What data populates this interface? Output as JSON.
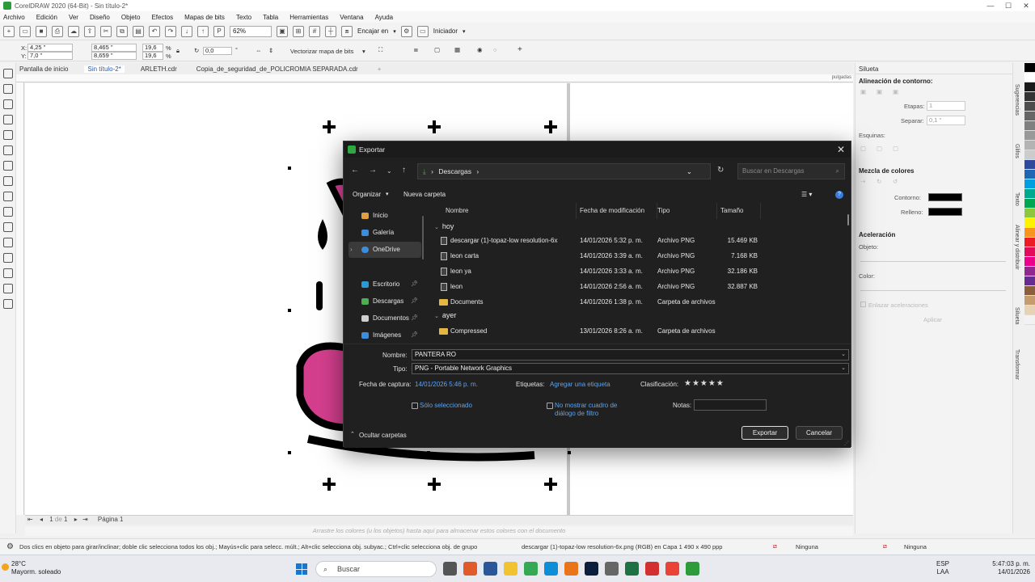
{
  "app": {
    "title": "CorelDRAW 2020 (64-Bit) - Sin título-2*",
    "window_controls": [
      "—",
      "☐",
      "✕"
    ]
  },
  "menu": [
    "Archivo",
    "Edición",
    "Ver",
    "Diseño",
    "Objeto",
    "Efectos",
    "Mapas de bits",
    "Texto",
    "Tabla",
    "Herramientas",
    "Ventana",
    "Ayuda"
  ],
  "toolbar": {
    "zoom": "62%",
    "snap_label": "Encajar en",
    "launcher_label": "Iniciador"
  },
  "propbar": {
    "x": "4,25 \"",
    "y": "7,0 \"",
    "w": "8,465 \"",
    "h": "8,659 \"",
    "scale_w": "19,6",
    "scale_h": "19,6",
    "pct": "%",
    "angle": "0,0",
    "vectorize": "Vectorizar mapa de bits"
  },
  "doc_tabs": [
    {
      "label": "Pantalla de inicio",
      "active": false
    },
    {
      "label": "Sin título-2*",
      "active": true
    },
    {
      "label": "ARLETH.cdr",
      "active": false
    },
    {
      "label": "Copia_de_seguridad_de_POLICROMIA SEPARADA.cdr",
      "active": false
    }
  ],
  "ruler_unit": "pulgadas",
  "page_nav": {
    "current": "1",
    "of": "de",
    "total": "1",
    "page_tab": "Página 1"
  },
  "color_hint": "Arrastre los colores (u los objetos) hasta aquí para almacenar estos colores con el documento",
  "status": {
    "hint": "Dos clics en objeto para girar/inclinar; doble clic selecciona todos los obj.; Mayús+clic para selecc. múlt.; Alt+clic selecciona obj. subyac.; Ctrl+clic selecciona obj. de grupo",
    "object_info": "descargar (1)-topaz-low resolution-6x.png (RGB) en Capa 1 490 x 490 ppp",
    "fill": "Ninguna",
    "outline": "Ninguna"
  },
  "docker": {
    "title": "Silueta",
    "alignment_title": "Alineación de contorno:",
    "steps_label": "Etapas:",
    "steps_value": "1",
    "offset_label": "Separar:",
    "offset_value": "0,1 \"",
    "corners_label": "Esquinas:",
    "color_blend_title": "Mezcla de colores",
    "outline_label": "Contorno:",
    "fill_label": "Relleno:",
    "accel_title": "Aceleración",
    "object_label": "Objeto:",
    "color_label": "Color:",
    "link_accel": "Enlazar aceleraciones",
    "apply": "Aplicar"
  },
  "vertical_tabs": [
    "Sugerencias",
    "Glifos",
    "Texto",
    "Alinear y distribuir",
    "Silueta",
    "Transformar"
  ],
  "palette": [
    "#000000",
    "#ffffff",
    "#1a1a1a",
    "#333333",
    "#4d4d4d",
    "#666666",
    "#808080",
    "#999999",
    "#b3b3b3",
    "#cccccc",
    "#2f4a9c",
    "#1f66b3",
    "#00a0e0",
    "#00a88f",
    "#00a651",
    "#8dc63f",
    "#fff200",
    "#f7941d",
    "#ed1c24",
    "#e30b5c",
    "#ec008c",
    "#92278f",
    "#662d91",
    "#8b5e3c",
    "#c69c6d",
    "#e6d2b5",
    "#f2f2f2"
  ],
  "taskbar": {
    "temp": "28°C",
    "weather": "Mayorm. soleado",
    "search": "Buscar",
    "lang": "ESP",
    "lang2": "LAA",
    "time": "5:47:03 p. m.",
    "date": "14/01/2026"
  },
  "dialog": {
    "title": "Exportar",
    "path": "Descargas",
    "search_placeholder": "Buscar en Descargas",
    "organize": "Organizar",
    "new_folder": "Nueva carpeta",
    "nav": [
      {
        "label": "Inicio",
        "color": "#e0a040"
      },
      {
        "label": "Galería",
        "color": "#3a8ee0"
      },
      {
        "label": "OneDrive",
        "color": "#3a8ee0"
      },
      {
        "label": "Escritorio",
        "color": "#2b9ad8"
      },
      {
        "label": "Descargas",
        "color": "#4caf50"
      },
      {
        "label": "Documentos",
        "color": "#cfcfcf"
      },
      {
        "label": "Imágenes",
        "color": "#3a8ee0"
      }
    ],
    "columns": {
      "name": "Nombre",
      "date": "Fecha de modificación",
      "type": "Tipo",
      "size": "Tamaño"
    },
    "group_today": "hoy",
    "group_yesterday": "ayer",
    "files": [
      {
        "name": "descargar (1)-topaz-low resolution-6x",
        "date": "14/01/2026 5:32 p. m.",
        "type": "Archivo PNG",
        "size": "15.469 KB",
        "folder": false
      },
      {
        "name": "leon carta",
        "date": "14/01/2026 3:39 a. m.",
        "type": "Archivo PNG",
        "size": "7.168 KB",
        "folder": false
      },
      {
        "name": "leon ya",
        "date": "14/01/2026 3:33 a. m.",
        "type": "Archivo PNG",
        "size": "32.186 KB",
        "folder": false
      },
      {
        "name": "leon",
        "date": "14/01/2026 2:56 a. m.",
        "type": "Archivo PNG",
        "size": "32.887 KB",
        "folder": false
      },
      {
        "name": "Documents",
        "date": "14/01/2026 1:38 p. m.",
        "type": "Carpeta de archivos",
        "size": "",
        "folder": true
      },
      {
        "name": "Compressed",
        "date": "13/01/2026 8:26 a. m.",
        "type": "Carpeta de archivos",
        "size": "",
        "folder": true
      }
    ],
    "name_label": "Nombre:",
    "name_value": "PANTERA RO",
    "type_label": "Tipo:",
    "type_value": "PNG - Portable Network Graphics",
    "capture_label": "Fecha de captura:",
    "capture_value": "14/01/2026 5:46 p. m.",
    "tags_label": "Etiquetas:",
    "tags_value": "Agregar una etiqueta",
    "rating_label": "Clasificación:",
    "rating_stars": "★★★★★",
    "only_selected": "Sólo seleccionado",
    "no_filter_1": "No mostrar cuadro de",
    "no_filter_2": "diálogo de filtro",
    "notes_label": "Notas:",
    "hide_folders": "Ocultar carpetas",
    "export_btn": "Exportar",
    "cancel_btn": "Cancelar"
  }
}
